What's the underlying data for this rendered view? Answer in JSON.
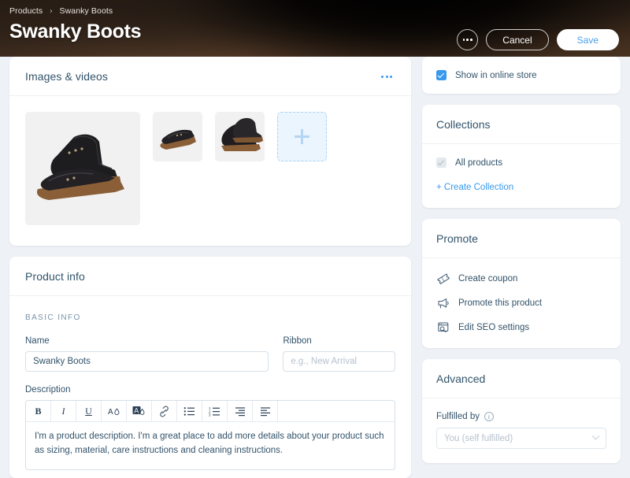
{
  "header": {
    "breadcrumb": {
      "parent": "Products",
      "separator": "›",
      "current": "Swanky Boots"
    },
    "title": "Swanky Boots",
    "more_label": "More actions",
    "cancel_label": "Cancel",
    "save_label": "Save",
    "accent_blue": "#3899ec",
    "save_text_color": "#4a9fe8"
  },
  "images_card": {
    "title": "Images & videos",
    "menu_label": "More options",
    "thumbnails": [
      {
        "alt": "Swanky Boots pair top view"
      },
      {
        "alt": "Swanky Boots side view"
      },
      {
        "alt": "Swanky Boots angled pair"
      }
    ],
    "add_label": "+"
  },
  "product_info": {
    "title": "Product info",
    "section_label": "BASIC INFO",
    "name": {
      "label": "Name",
      "value": "Swanky Boots",
      "placeholder": ""
    },
    "ribbon": {
      "label": "Ribbon",
      "value": "",
      "placeholder": "e.g., New Arrival"
    },
    "description": {
      "label": "Description",
      "text": "I'm a product description. I'm a great place to add more details about your product such as sizing, material, care instructions and cleaning instructions.",
      "toolbar": [
        {
          "name": "bold-icon",
          "label": "B"
        },
        {
          "name": "italic-icon",
          "label": "I"
        },
        {
          "name": "underline-icon",
          "label": "U"
        },
        {
          "name": "text-color-icon",
          "label": "A"
        },
        {
          "name": "highlight-color-icon",
          "label": "A"
        },
        {
          "name": "link-icon",
          "label": "Link"
        },
        {
          "name": "bulleted-list-icon",
          "label": "Bulleted list"
        },
        {
          "name": "numbered-list-icon",
          "label": "Numbered list"
        },
        {
          "name": "align-right-icon",
          "label": "Align right"
        },
        {
          "name": "align-left-icon",
          "label": "Align left"
        }
      ]
    }
  },
  "sidebar": {
    "online_store": {
      "label": "Show in online store",
      "checked": true
    },
    "collections": {
      "title": "Collections",
      "items": [
        {
          "label": "All products",
          "checked": true,
          "disabled": true
        }
      ],
      "create_link": "+ Create Collection"
    },
    "promote": {
      "title": "Promote",
      "items": [
        {
          "icon": "coupon-icon",
          "label": "Create coupon"
        },
        {
          "icon": "megaphone-icon",
          "label": "Promote this product"
        },
        {
          "icon": "seo-icon",
          "label": "Edit SEO settings"
        }
      ]
    },
    "advanced": {
      "title": "Advanced",
      "fulfilled_by": {
        "label": "Fulfilled by",
        "info_glyph": "i",
        "value": "You (self fulfilled)",
        "placeholder": "You (self fulfilled)"
      }
    }
  }
}
